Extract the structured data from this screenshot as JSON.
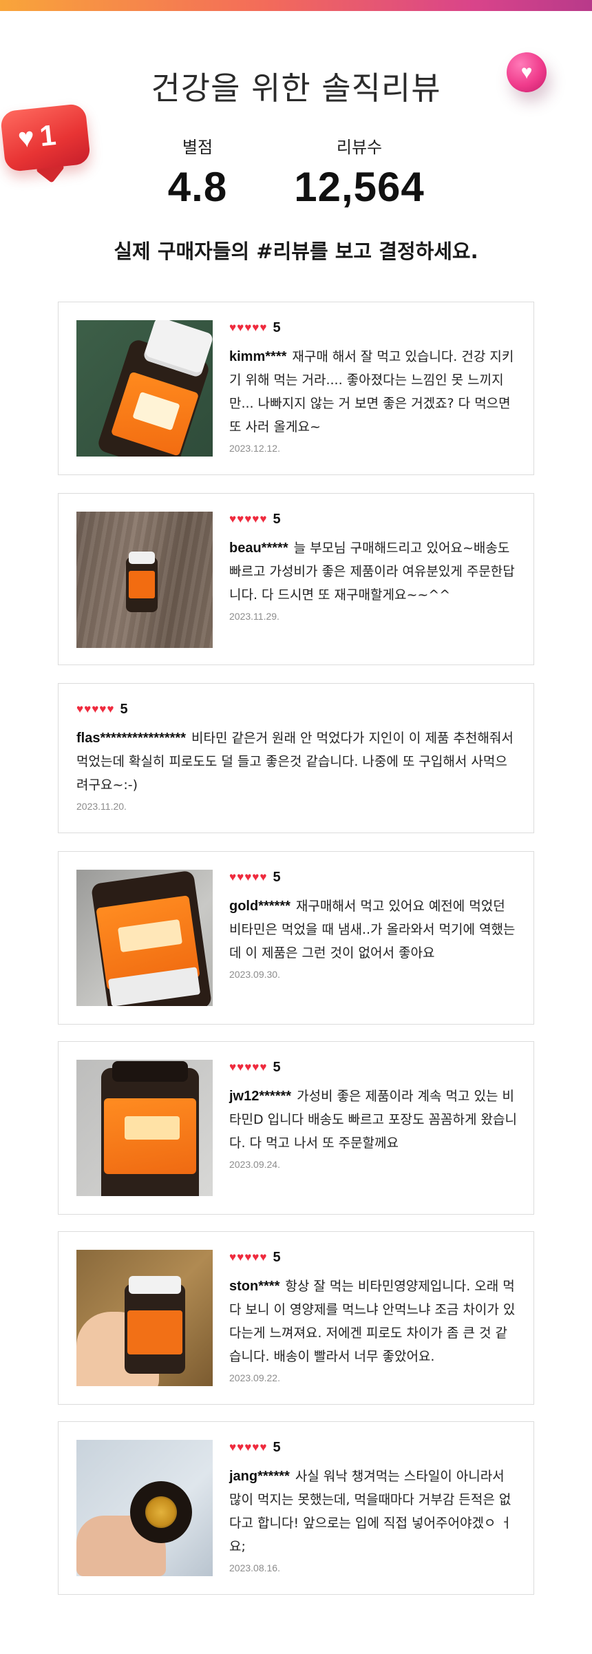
{
  "header": {
    "title": "건강을 위한 솔직리뷰",
    "like_count": "1",
    "rating_label": "별점",
    "rating_value": "4.8",
    "review_count_label": "리뷰수",
    "review_count_value": "12,564",
    "tagline": "실제 구매자들의 #리뷰를 보고 결정하세요."
  },
  "colors": {
    "accent_gradient": [
      "#f9a53a",
      "#f36b5a",
      "#d9448a",
      "#b83a8a"
    ],
    "heart": "#ef2b3e",
    "date": "#8c8c8c",
    "border": "#dcdcdc"
  },
  "reviews": [
    {
      "hearts": "♥♥♥♥♥",
      "score": "5",
      "user": "kimm****",
      "text": "재구매 해서 잘 먹고 있습니다. 건강 지키기 위해 먹는 거라.... 좋아졌다는 느낌인 못 느끼지만... 나빠지지 않는 거 보면 좋은 거겠죠? 다 먹으면 또 사러 올게요~",
      "date": "2023.12.12.",
      "photo": "bottle-closeup-photo"
    },
    {
      "hearts": "♥♥♥♥♥",
      "score": "5",
      "user": "beau*****",
      "text": "늘 부모님 구매해드리고 있어요~배송도 빠르고 가성비가 좋은 제품이라 여유분있게 주문한답니다. 다 드시면 또 재구매할게요~~^^",
      "date": "2023.11.29.",
      "photo": "bottle-on-floor-photo"
    },
    {
      "hearts": "♥♥♥♥♥",
      "score": "5",
      "user": "flas****************",
      "text": "비타민 같은거 원래 안 먹었다가 지인이 이 제품 추천해줘서 먹었는데 확실히 피로도도 덜 들고 좋은것 같습니다. 나중에 또 구입해서 사먹으려구요~:-)",
      "date": "2023.11.20.",
      "photo": ""
    },
    {
      "hearts": "♥♥♥♥♥",
      "score": "5",
      "user": "gold******",
      "text": "재구매해서 먹고 있어요 예전에 먹었던 비타민은 먹었을 때 냄새..가 올라와서 먹기에 역했는데 이 제품은 그런 것이 없어서 좋아요",
      "date": "2023.09.30.",
      "photo": "vitamin-d-label-photo"
    },
    {
      "hearts": "♥♥♥♥♥",
      "score": "5",
      "user": "jw12******",
      "text": "가성비 좋은 제품이라 계속 먹고 있는 비타민D 입니다 배송도 빠르고 포장도 꼼꼼하게 왔습니다. 다 먹고 나서 또 주문할께요",
      "date": "2023.09.24.",
      "photo": "bottle-front-photo"
    },
    {
      "hearts": "♥♥♥♥♥",
      "score": "5",
      "user": "ston****",
      "text": "항상 잘 먹는 비타민영양제입니다. 오래 먹다 보니 이 영양제를 먹느냐 안먹느냐 조금 차이가 있다는게 느껴져요. 저에겐 피로도 차이가 좀 큰 것 같습니다. 배송이 빨라서 너무 좋았어요.",
      "date": "2023.09.22.",
      "photo": "bottle-in-hand-photo"
    },
    {
      "hearts": "♥♥♥♥♥",
      "score": "5",
      "user": "jang******",
      "text": "사실 워낙 챙겨먹는 스타일이 아니라서 많이 먹지는 못했는데, 먹을때마다 거부감 든적은 없다고 합니다! 앞으로는 입에 직접 넣어주어야겠ㅇ ㅓ요;",
      "date": "2023.08.16.",
      "photo": "open-bottle-capsules-photo"
    }
  ]
}
